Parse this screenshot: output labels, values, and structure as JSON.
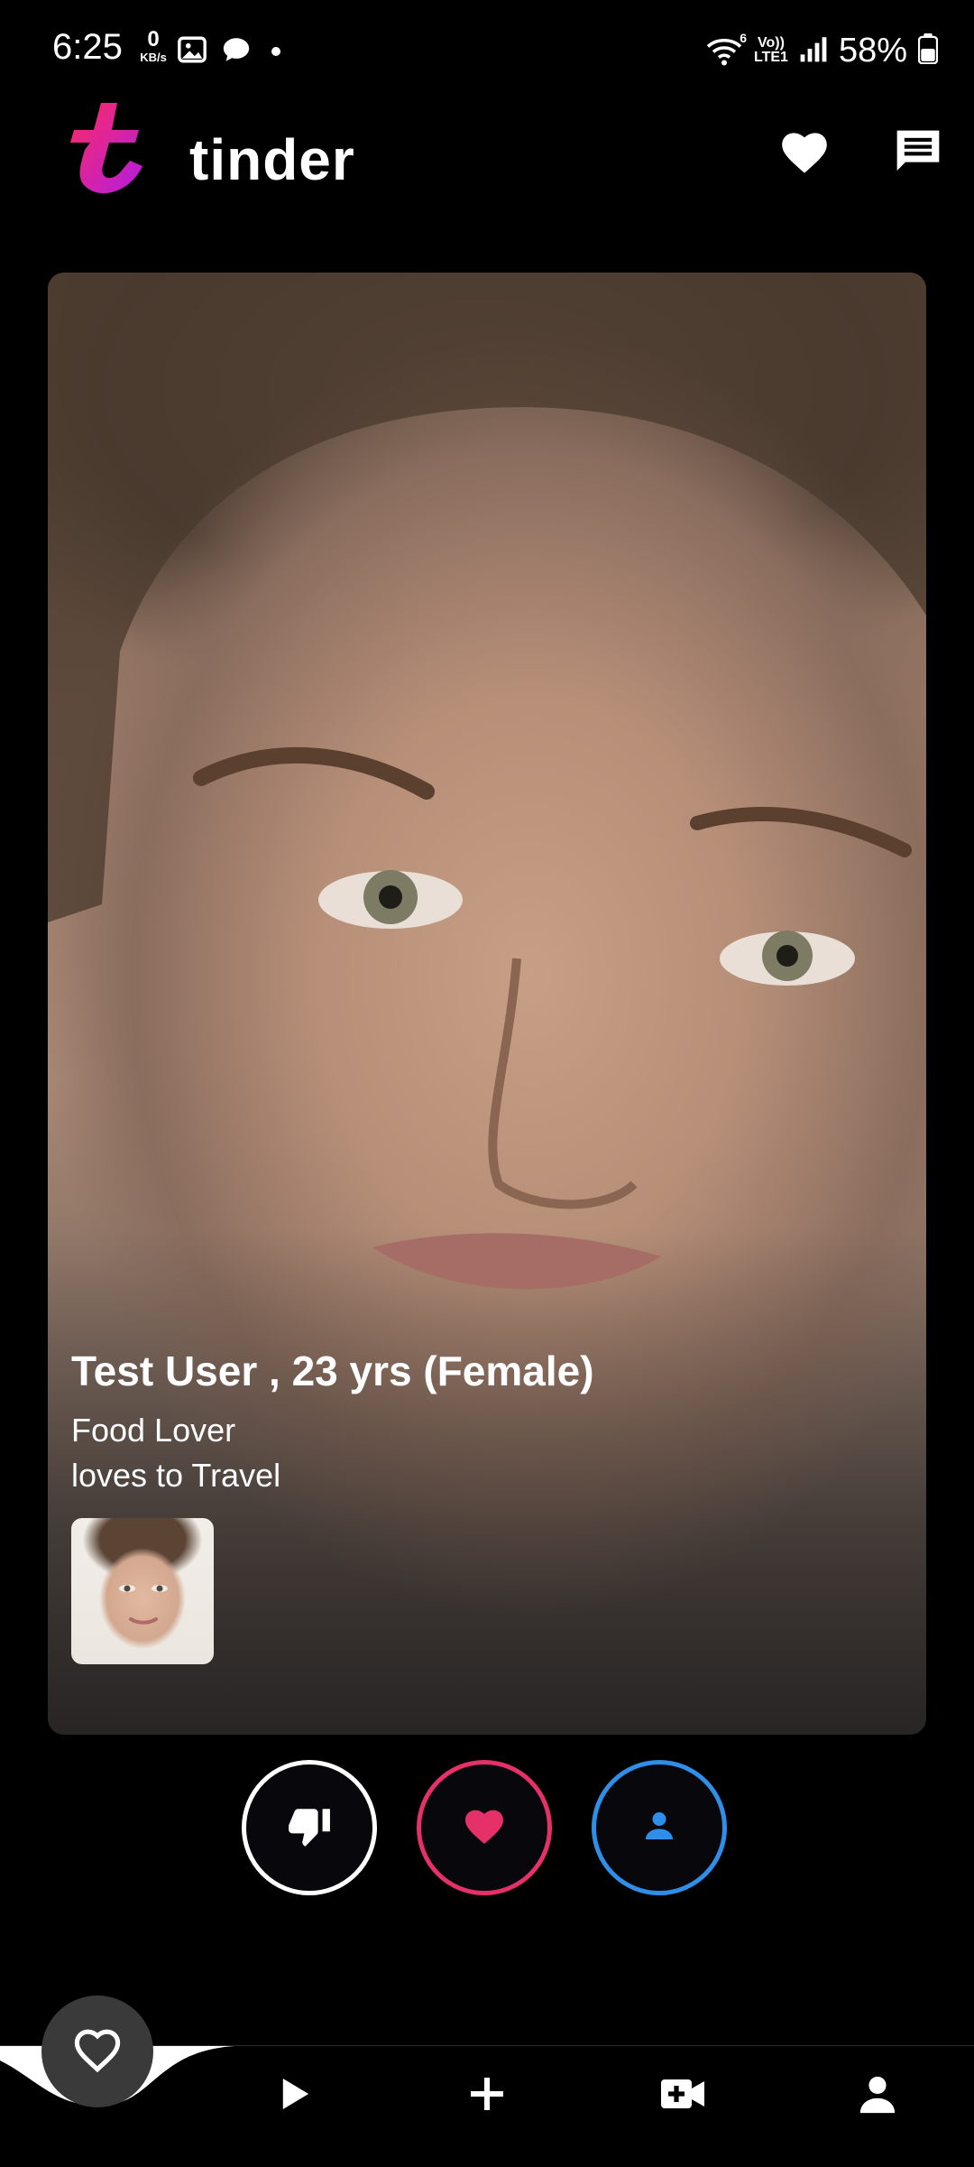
{
  "status_bar": {
    "time": "6:25",
    "net_speed_value": "0",
    "net_speed_unit": "KB/s",
    "lte_top": "Vo))",
    "lte_bottom": "LTE1",
    "wifi_label": "6",
    "battery": "58%"
  },
  "header": {
    "app_name": "tinder",
    "logo_icon": "tinder-logo",
    "likes_icon": "heart-icon",
    "messages_icon": "chat-icon"
  },
  "card": {
    "name_line": "Test User , 23 yrs (Female)",
    "bio": [
      "Food Lover",
      "loves to Travel"
    ]
  },
  "actions": {
    "dislike_icon": "thumbs-down-icon",
    "like_icon": "heart-icon",
    "profile_icon": "person-icon"
  },
  "bottom_nav": {
    "items": [
      "favorites-icon",
      "play-icon",
      "plus-icon",
      "video-add-icon",
      "person-icon"
    ]
  },
  "colors": {
    "brand_pink": "#e5306a",
    "profile_blue": "#2f8ee8",
    "background": "#000000"
  }
}
